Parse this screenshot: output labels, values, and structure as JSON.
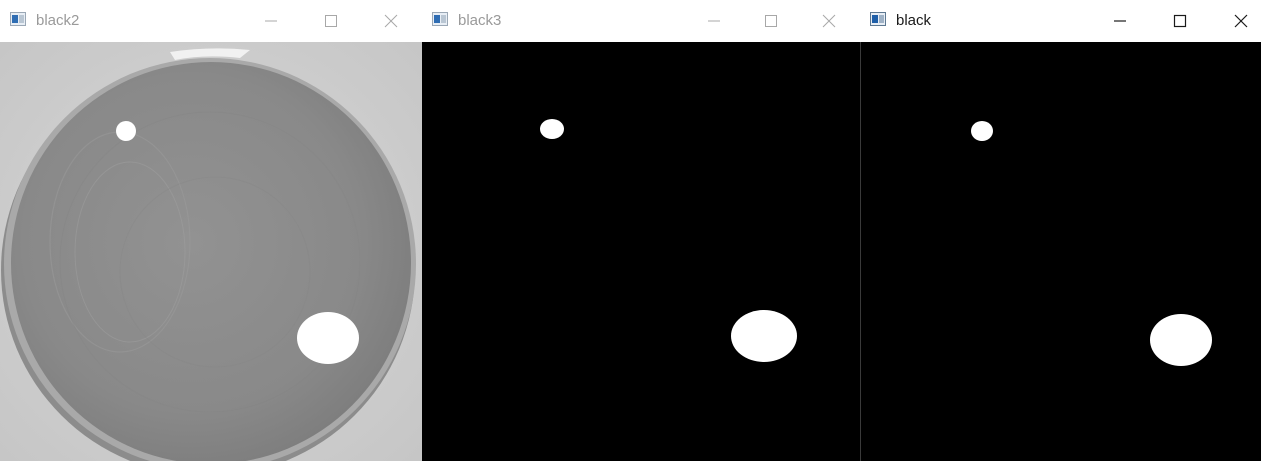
{
  "windows": [
    {
      "title": "black2",
      "state": "inactive",
      "content": "grayscale disc image with two white spots",
      "controls": [
        "minimize",
        "maximize",
        "close"
      ]
    },
    {
      "title": "black3",
      "state": "inactive",
      "content": "black binary mask with two white spots",
      "controls": [
        "minimize",
        "maximize",
        "close"
      ]
    },
    {
      "title": "black",
      "state": "active",
      "content": "black binary mask with two white spots",
      "controls": [
        "minimize",
        "maximize",
        "close"
      ]
    }
  ],
  "icons": {
    "app": "image-window-icon",
    "minimize": "minimize-icon",
    "maximize": "maximize-icon",
    "close": "close-icon"
  },
  "colors": {
    "titlebar_bg": "#ffffff",
    "inactive_text": "#9a9a9a",
    "active_text": "#1a1a1a",
    "mask_bg": "#000000",
    "spot": "#ffffff",
    "disc_gray": "#8c8c8c",
    "photo_bg": "#d2d2d2"
  }
}
